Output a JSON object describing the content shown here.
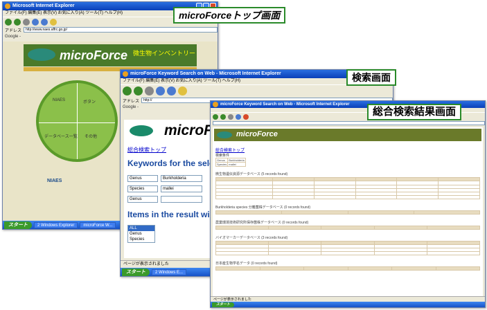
{
  "callouts": {
    "w1": "microForceトップ画面",
    "w2": "検索画面",
    "w3": "総合検索結果画面"
  },
  "w1": {
    "title": "Microsoft Internet Explorer",
    "menu": "ファイル(F)  編集(E)  表示(V)  お気に入り(A)  ツール(T)  ヘルプ(H)",
    "address": "http://www.naes.affrc.go.jp/",
    "google": "Google -",
    "logo": "microForce",
    "banner": "微生物インベントリー",
    "pie": [
      "NIAES",
      "ボタン",
      "データベース一覧",
      "その他"
    ],
    "start": "スタート",
    "tasks": [
      "2 Windows Explorer",
      "microForce W..."
    ]
  },
  "w2": {
    "title": "microForce Keyword Search on Web - Microsoft Internet Explorer",
    "menu": "ファイル(F)  編集(E)  表示(V)  お気に入り(A)  ツール(T)  ヘルプ(H)",
    "address": "http://",
    "google": "Google -",
    "logo": "microFo",
    "toplink": "総合検索トップ",
    "heading": "Keywords for the sele",
    "rows": [
      {
        "field": "Genus",
        "value": "Burkholderia"
      },
      {
        "field": "Species",
        "value": "mallei"
      },
      {
        "field": "Genus",
        "value": ""
      }
    ],
    "heading2": "Items in the result wi",
    "list": [
      "ALL",
      "Genus",
      "Species"
    ],
    "status": "ページが表示されました",
    "start": "スタート",
    "tasks": [
      "2 Windows E..."
    ]
  },
  "w3": {
    "title": "microForce Keyword Search on Web - Microsoft Internet Explorer",
    "logo": "microForce",
    "toplink": "総合検索トップ",
    "cond_label": "検索条件",
    "cond": [
      [
        "Genus",
        "Burkholderia"
      ],
      [
        "Species",
        "mallei"
      ]
    ],
    "sections": [
      "微生物遺伝資源データベース (5 records found)",
      "Burkholderia species 分離菌株データベース (0 records found)",
      "農業環境技術研究所保存菌株データベース (0 records found)",
      "バイオマーカーデータベース (3 records found)",
      "日本産生物学名データ (0 records found)"
    ],
    "status": "ページが表示されました",
    "start": "スタート"
  }
}
